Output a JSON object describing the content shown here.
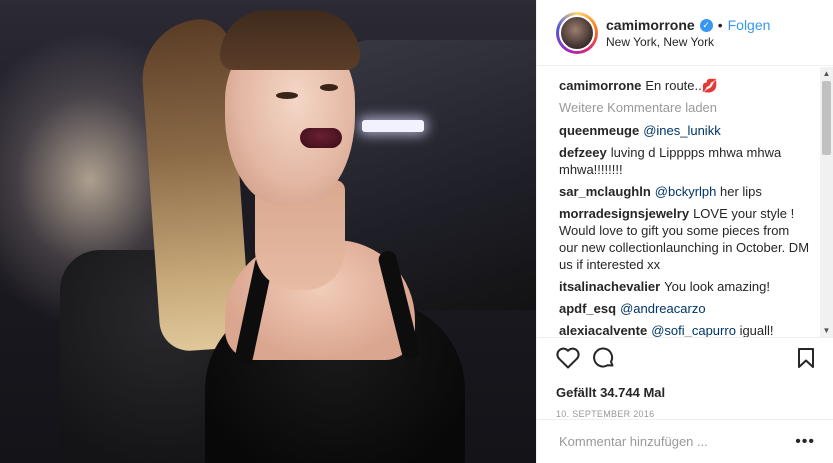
{
  "header": {
    "username": "camimorrone",
    "follow_label": "Folgen",
    "separator": "•",
    "location": "New York, New York"
  },
  "caption": {
    "username": "camimorrone",
    "text": "En route..",
    "emoji": "💋"
  },
  "load_more_label": "Weitere Kommentare laden",
  "comments": [
    {
      "user": "queenmeuge",
      "mention": "@ines_lunikk",
      "text": ""
    },
    {
      "user": "defzeey",
      "mention": "",
      "text": "luving d Lipppps mhwa mhwa mhwa!!!!!!!!"
    },
    {
      "user": "sar_mclaughln",
      "mention": "@bckyrlph",
      "text": "her lips"
    },
    {
      "user": "morradesignsjewelry",
      "mention": "",
      "text": "LOVE your style ! Would love to gift you some pieces from our new collectionlaunching in October. DM us if interested xx"
    },
    {
      "user": "itsalinachevalier",
      "mention": "",
      "text": "You look amazing!"
    },
    {
      "user": "apdf_esq",
      "mention": "@andreacarzo",
      "text": ""
    },
    {
      "user": "alexiacalvente",
      "mention": "@sofi_capurro",
      "text": "iguall!"
    }
  ],
  "likes_label": "Gefällt 34.744 Mal",
  "date_label": "10. SEPTEMBER 2016",
  "comment_input": {
    "placeholder": "Kommentar hinzufügen ..."
  },
  "more_label": "•••",
  "icons": {
    "like": "heart-icon",
    "comment": "comment-icon",
    "save": "bookmark-icon",
    "verified": "verified-badge-icon"
  },
  "colors": {
    "accent": "#3897f0",
    "mention": "#003569",
    "muted": "#999999"
  }
}
